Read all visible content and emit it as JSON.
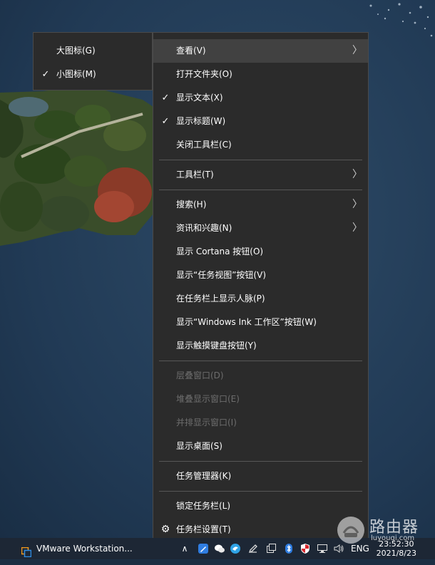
{
  "submenu": {
    "items": [
      {
        "label": "大图标(G)",
        "checked": false
      },
      {
        "label": "小图标(M)",
        "checked": true
      }
    ]
  },
  "menu": {
    "items": [
      {
        "label": "查看(V)",
        "checked": false,
        "submenu": true,
        "highlighted": true
      },
      {
        "label": "打开文件夹(O)",
        "checked": false
      },
      {
        "label": "显示文本(X)",
        "checked": true
      },
      {
        "label": "显示标题(W)",
        "checked": true
      },
      {
        "label": "关闭工具栏(C)",
        "checked": false
      },
      {
        "label": "工具栏(T)",
        "submenu": true
      },
      {
        "label": "搜索(H)",
        "submenu": true
      },
      {
        "label": "资讯和兴趣(N)",
        "submenu": true
      },
      {
        "label": "显示 Cortana 按钮(O)"
      },
      {
        "label": "显示“任务视图”按钮(V)"
      },
      {
        "label": "在任务栏上显示人脉(P)"
      },
      {
        "label": "显示“Windows Ink 工作区”按钮(W)"
      },
      {
        "label": "显示触摸键盘按钮(Y)"
      },
      {
        "label": "层叠窗口(D)",
        "disabled": true
      },
      {
        "label": "堆叠显示窗口(E)",
        "disabled": true
      },
      {
        "label": "并排显示窗口(I)",
        "disabled": true
      },
      {
        "label": "显示桌面(S)"
      },
      {
        "label": "任务管理器(K)"
      },
      {
        "label": "锁定任务栏(L)"
      },
      {
        "label": "任务栏设置(T)",
        "icon": "gear-icon"
      }
    ]
  },
  "taskbar": {
    "app_label": "VMware Workstation...",
    "app_icon": "vmware-icon",
    "language": "ENG",
    "time": "23:52:30",
    "date": "2021/8/23",
    "tray_icons": [
      "chevron-up-icon",
      "pen-icon",
      "wechat-icon",
      "bird-icon",
      "edit-icon",
      "window-icon",
      "bluetooth-icon",
      "shield-icon",
      "network-icon",
      "volume-icon"
    ]
  },
  "watermark": {
    "text": "路由器",
    "url": "luyouqi.com"
  },
  "colors": {
    "menu_bg": "#2b2b2b",
    "menu_hover": "#414141",
    "disabled_text": "#6d6d6d",
    "taskbar_bg": "#1d2735"
  }
}
